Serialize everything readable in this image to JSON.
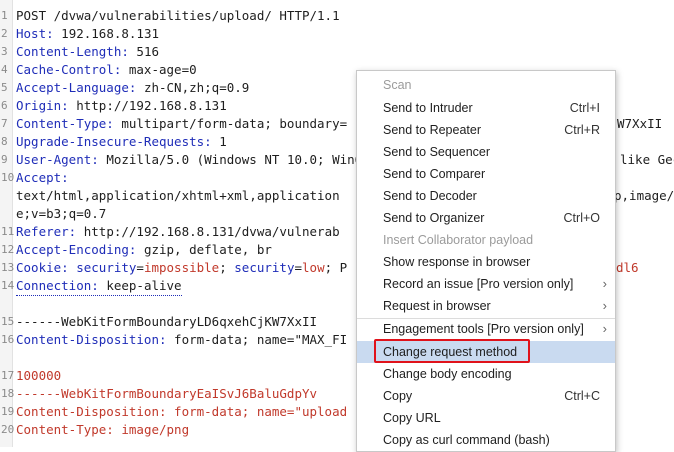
{
  "request": {
    "line1": "POST /dvwa/vulnerabilities/upload/ HTTP/1.1",
    "host_k": "Host:",
    "host_v": " 192.168.8.131",
    "cl_k": "Content-Length:",
    "cl_v": " 516",
    "cc_k": "Cache-Control:",
    "cc_v": " max-age=0",
    "al_k": "Accept-Language:",
    "al_v": " zh-CN,zh;q=0.9",
    "or_k": "Origin:",
    "or_v": " http://192.168.8.131",
    "ct_k": "Content-Type:",
    "ct_v": " multipart/form-data; boundary=",
    "ct_tail": "W7XxII",
    "uir_k": "Upgrade-Insecure-Requests:",
    "uir_v": " 1",
    "ua_k": "User-Agent:",
    "ua_v": " Mozilla/5.0 (Windows NT 10.0; Win6",
    "ua_tail": "like Gec",
    "acc_k": "Accept:",
    "acc_v1": "text/html,application/xhtml+xml,application",
    "acc_tail": "p,image/a",
    "acc_v2": "e;v=b3;q=0.7",
    "ref_k": "Referer:",
    "ref_v": " http://192.168.8.131/dvwa/vulnerab",
    "ae_k": "Accept-Encoding:",
    "ae_v": " gzip, deflate, br",
    "ck_k": "Cookie:",
    "ck_a": " security",
    "ck_eq1": "=",
    "ck_b": "impossible",
    "ck_sep": "; ",
    "ck_c": "security",
    "ck_eq2": "=",
    "ck_d": "low",
    "ck_e": "; P",
    "ck_tail": "dl6",
    "cn_k": "Connection:",
    "cn_v": " keep-alive",
    "bnd1": "------WebKitFormBoundaryLD6qxehCjKW7XxII",
    "cd1_k": "Content-Disposition:",
    "cd1_v": " form-data; name=\"MAX_FI",
    "val": "100000",
    "bnd2": "------WebKitFormBoundaryEaISvJ6BaluGdpYv",
    "cd2_k": "Content-Disposition:",
    "cd2_v": " form-data; name=\"upload",
    "ct2_k": "Content-Type:",
    "ct2_v": " image/png"
  },
  "line_numbers": [
    "1",
    "2",
    "3",
    "4",
    "5",
    "6",
    "7",
    "8",
    "9",
    "10",
    "",
    "",
    "11",
    "12",
    "13",
    "14",
    "",
    "15",
    "16",
    "",
    "17",
    "18",
    "19",
    "20"
  ],
  "menu": {
    "scan": "Scan",
    "intruder": "Send to Intruder",
    "intruder_sc": "Ctrl+I",
    "repeater": "Send to Repeater",
    "repeater_sc": "Ctrl+R",
    "sequencer": "Send to Sequencer",
    "comparer": "Send to Comparer",
    "decoder": "Send to Decoder",
    "organizer": "Send to Organizer",
    "organizer_sc": "Ctrl+O",
    "collab": "Insert Collaborator payload",
    "show_resp": "Show response in browser",
    "record_issue": "Record an issue [Pro version only]",
    "req_browser": "Request in browser",
    "engagement": "Engagement tools [Pro version only]",
    "change_method": "Change request method",
    "change_enc": "Change body encoding",
    "copy": "Copy",
    "copy_sc": "Ctrl+C",
    "copy_url": "Copy URL",
    "copy_curl": "Copy as curl command (bash)"
  }
}
